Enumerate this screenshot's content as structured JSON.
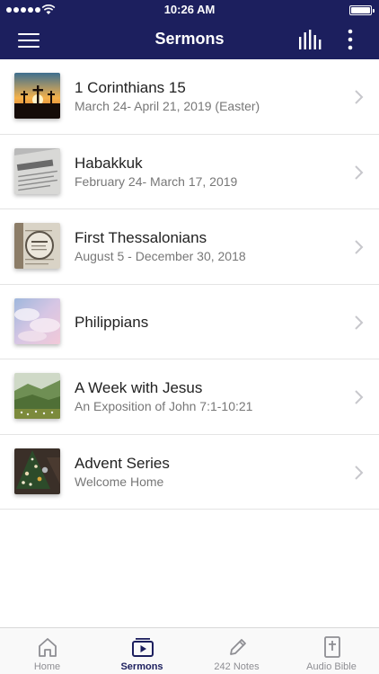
{
  "status_bar": {
    "time": "10:26 AM"
  },
  "nav": {
    "title": "Sermons"
  },
  "sermons": [
    {
      "title": "1 Corinthians 15",
      "subtitle": "March 24- April 21, 2019 (Easter)",
      "thumbnail": "crosses-sunset-image"
    },
    {
      "title": "Habakkuk",
      "subtitle": "February 24- March 17, 2019",
      "thumbnail": "bible-page-habakkuk-image"
    },
    {
      "title": "First Thessalonians",
      "subtitle": "August 5 - December 30, 2018",
      "thumbnail": "magnifier-bible-image"
    },
    {
      "title": "Philippians",
      "subtitle": "",
      "thumbnail": "pastel-clouds-image"
    },
    {
      "title": "A Week with Jesus",
      "subtitle": "An Exposition of John 7:1-10:21",
      "thumbnail": "green-valley-image"
    },
    {
      "title": "Advent Series",
      "subtitle": "Welcome Home",
      "thumbnail": "christmas-tree-image"
    }
  ],
  "tabs": [
    {
      "label": "Home",
      "icon": "home-icon",
      "active": false
    },
    {
      "label": "Sermons",
      "icon": "sermons-play-icon",
      "active": true
    },
    {
      "label": "242 Notes",
      "icon": "pencil-icon",
      "active": false
    },
    {
      "label": "Audio Bible",
      "icon": "bible-cross-icon",
      "active": false
    }
  ],
  "colors": {
    "nav_background": "#1c1f5e",
    "active_tab": "#1c1f5e",
    "inactive_tab": "#8e8e93",
    "chevron": "#c7c7cc"
  }
}
